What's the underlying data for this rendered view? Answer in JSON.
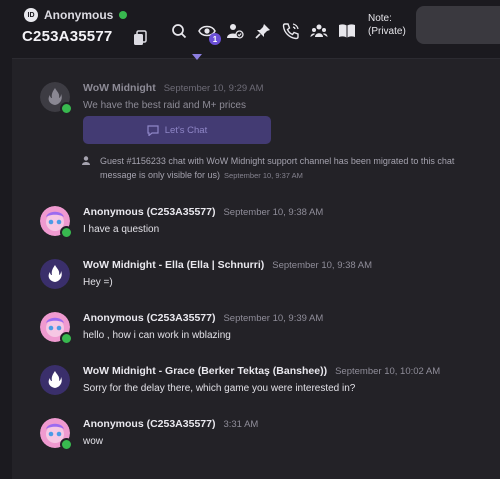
{
  "header": {
    "user_name": "Anonymous",
    "user_id": "C253A35577",
    "note_label": "Note:",
    "note_value": "(Private)",
    "badge_count": "1",
    "id_badge": "ID"
  },
  "messages": [
    {
      "name": "WoW Midnight",
      "time": "September 10, 9:29 AM",
      "text": "We have the best raid and M+ prices",
      "button": "Let's Chat"
    },
    {
      "name": "Anonymous (C253A35577)",
      "time": "September 10, 9:38 AM",
      "text": "I have a question"
    },
    {
      "name": "WoW Midnight - Ella (Ella | Schnurri)",
      "time": "September 10, 9:38 AM",
      "text": "Hey =)"
    },
    {
      "name": "Anonymous (C253A35577)",
      "time": "September 10, 9:39 AM",
      "text": "hello , how i can work in wblazing"
    },
    {
      "name": "WoW Midnight - Grace (Berker Tektaş (Banshee))",
      "time": "September 10, 10:02 AM",
      "text": "Sorry for the delay there, which game you were interested in?"
    },
    {
      "name": "Anonymous (C253A35577)",
      "time": "3:31 AM",
      "text": "wow"
    }
  ],
  "system_notice": {
    "line1": "Guest #1156233 chat with WoW Midnight support channel has been migrated to this chat",
    "line2": "message is only visible for us)",
    "time": "September 10, 9:37 AM"
  },
  "colors": {
    "accent": "#6b4fd6",
    "online": "#38b94f",
    "background": "#232227"
  }
}
